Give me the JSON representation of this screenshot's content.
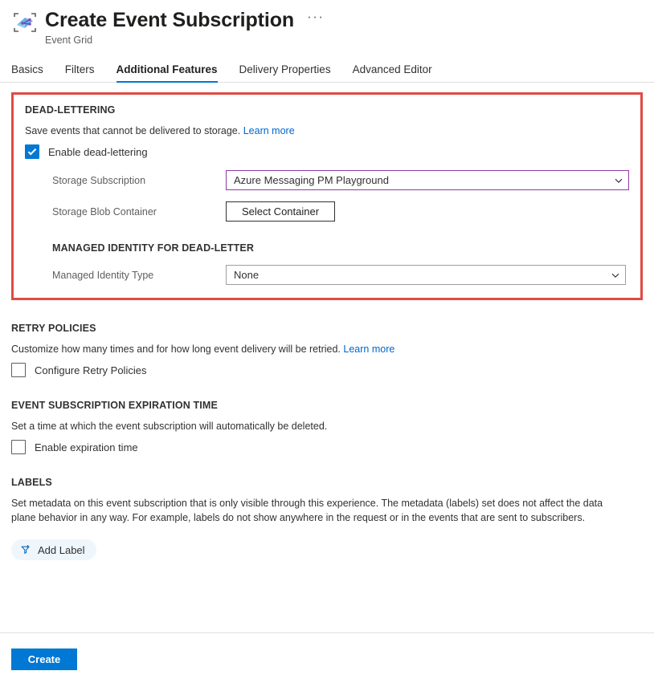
{
  "header": {
    "title": "Create Event Subscription",
    "subtitle": "Event Grid",
    "ellipsis": "···",
    "icon": "event-grid-resource-icon"
  },
  "tabs": [
    {
      "label": "Basics",
      "active": false
    },
    {
      "label": "Filters",
      "active": false
    },
    {
      "label": "Additional Features",
      "active": true
    },
    {
      "label": "Delivery Properties",
      "active": false
    },
    {
      "label": "Advanced Editor",
      "active": false
    }
  ],
  "dead_lettering": {
    "heading": "DEAD-LETTERING",
    "description": "Save events that cannot be delivered to storage.",
    "learn_more": "Learn more",
    "enable_checkbox": {
      "label": "Enable dead-lettering",
      "checked": true
    },
    "storage_subscription": {
      "label": "Storage Subscription",
      "value": "Azure Messaging PM Playground",
      "focused": true
    },
    "storage_blob_container": {
      "label": "Storage Blob Container",
      "button_label": "Select Container"
    },
    "managed_identity": {
      "heading": "MANAGED IDENTITY FOR DEAD-LETTER",
      "label": "Managed Identity Type",
      "value": "None"
    },
    "highlight_color": "#e04b43"
  },
  "retry_policies": {
    "heading": "RETRY POLICIES",
    "description": "Customize how many times and for how long event delivery will be retried.",
    "learn_more": "Learn more",
    "checkbox": {
      "label": "Configure Retry Policies",
      "checked": false
    }
  },
  "expiration": {
    "heading": "EVENT SUBSCRIPTION EXPIRATION TIME",
    "description": "Set a time at which the event subscription will automatically be deleted.",
    "checkbox": {
      "label": "Enable expiration time",
      "checked": false
    }
  },
  "labels": {
    "heading": "LABELS",
    "description": "Set metadata on this event subscription that is only visible through this experience. The metadata (labels) set does not affect the data plane behavior in any way. For example, labels do not show anywhere in the request or in the events that are sent to subscribers.",
    "add_label_button": "Add Label"
  },
  "footer": {
    "create_label": "Create",
    "accent_color": "#0078d4"
  }
}
